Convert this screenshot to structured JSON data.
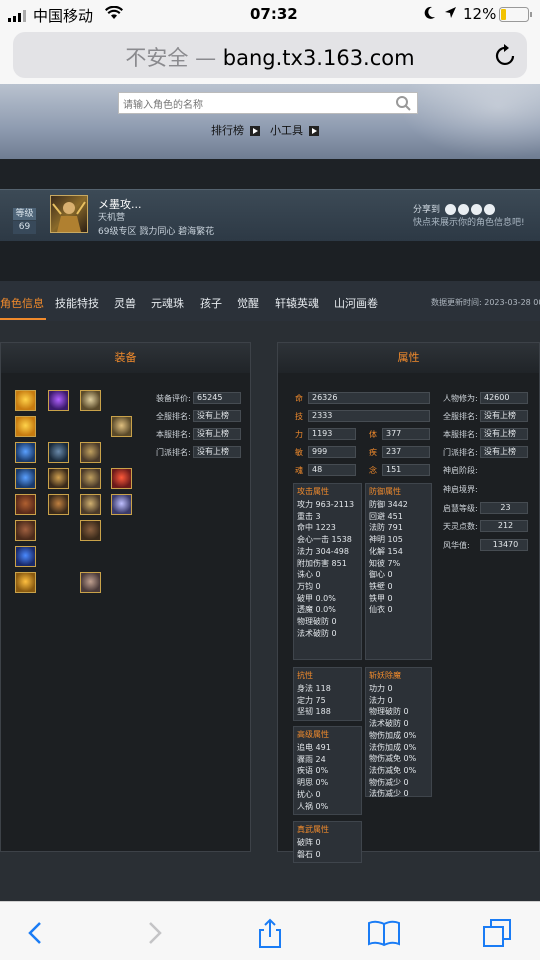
{
  "statusbar": {
    "carrier": "中国移动",
    "time": "07:32",
    "battery": "12%"
  },
  "browser": {
    "insecure_label": "不安全",
    "separator": "—",
    "domain": "bang.tx3.163.com"
  },
  "header": {
    "search_placeholder": "请输入角色的名称",
    "link_ranking": "排行榜",
    "link_tools": "小工具"
  },
  "profile": {
    "level_label": "等级",
    "level": "69",
    "name": "メ墨攻...",
    "class": "天机营",
    "server": "69级专区 戮力同心 碧海繁花",
    "share_label": "分享到",
    "share_tip": "快点来展示你的角色信息吧!"
  },
  "tabs": [
    "角色信息",
    "技能特技",
    "灵兽",
    "元魂珠",
    "孩子",
    "觉醒",
    "轩辕英魂",
    "山河画卷"
  ],
  "update_time_label": "数据更新时间:",
  "update_time": "2023-03-28 00",
  "equip_panel": {
    "title": "装备",
    "stats": [
      {
        "label": "装备评价:",
        "value": "65245"
      },
      {
        "label": "全服排名:",
        "value": "没有上榜"
      },
      {
        "label": "本服排名:",
        "value": "没有上榜"
      },
      {
        "label": "门派排名:",
        "value": "没有上榜"
      }
    ]
  },
  "attr_panel": {
    "title": "属性",
    "base": [
      {
        "label": "命",
        "value": "26326"
      },
      {
        "label": "技",
        "value": "2333"
      },
      {
        "label": "力",
        "value": "1193"
      },
      {
        "label": "体",
        "value": "377"
      },
      {
        "label": "敏",
        "value": "999"
      },
      {
        "label": "疾",
        "value": "237"
      },
      {
        "label": "魂",
        "value": "48"
      },
      {
        "label": "念",
        "value": "151"
      }
    ],
    "right": [
      {
        "label": "人物修为:",
        "value": "42600"
      },
      {
        "label": "全服排名:",
        "value": "没有上榜"
      },
      {
        "label": "本服排名:",
        "value": "没有上榜"
      },
      {
        "label": "门派排名:",
        "value": "没有上榜"
      },
      {
        "label": "神启阶段:",
        "value": ""
      },
      {
        "label": "神启境界:",
        "value": ""
      },
      {
        "label": "启慧等级:",
        "value": "23"
      },
      {
        "label": "天灵点数:",
        "value": "212"
      },
      {
        "label": "风华值:",
        "value": "13470"
      }
    ],
    "attack": {
      "title": "攻击属性",
      "lines": [
        "攻力 963-2113",
        "重击 3",
        "命中 1223",
        "会心一击 1538",
        "法力 304-498",
        "附加伤害 851",
        "诛心 0",
        "万钧 0",
        "破甲 0.0%",
        "透魔 0.0%",
        "物理破防 0",
        "法术破防 0"
      ]
    },
    "defense": {
      "title": "防御属性",
      "lines": [
        "防御 3442",
        "回避 451",
        "法防 791",
        "神明 105",
        "化解 154",
        "知彼 7%",
        "御心 0",
        "铁壁 0",
        "铁甲 0",
        "仙衣 0"
      ]
    },
    "resist": {
      "title": "抗性",
      "lines": [
        "身法 118",
        "定力 75",
        "坚韧 188"
      ]
    },
    "advanced": {
      "title": "高级属性",
      "lines": [
        "追电 491",
        "骤雨 24",
        "疾语 0%",
        "明思 0%",
        "扰心 0",
        "人祸 0%"
      ]
    },
    "zhenwu": {
      "title": "真武属性",
      "lines": [
        "破阵 0",
        "磐石 0"
      ]
    },
    "demon": {
      "title": "斩妖除魔",
      "lines": [
        "功力 0",
        "法力 0",
        "物理破防 0",
        "法术破防 0",
        "物伤加成 0%",
        "法伤加成 0%",
        "物伤减免 0%",
        "法伤减免 0%",
        "物伤减少 0",
        "法伤减少 0"
      ]
    }
  }
}
